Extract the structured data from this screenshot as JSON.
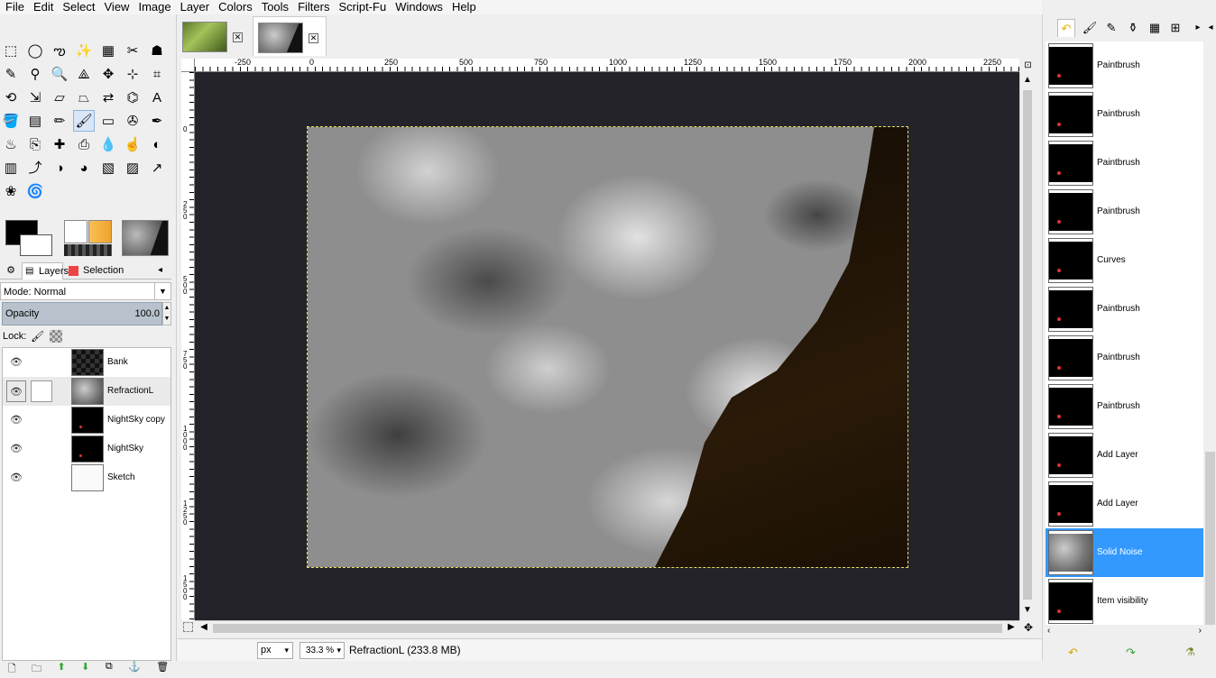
{
  "menubar": {
    "items": [
      "File",
      "Edit",
      "Select",
      "View",
      "Image",
      "Layer",
      "Colors",
      "Tools",
      "Filters",
      "Script-Fu",
      "Windows",
      "Help"
    ]
  },
  "toolbox": {
    "tools": [
      {
        "name": "rect-select-tool",
        "glyph": "⬚"
      },
      {
        "name": "ellipse-select-tool",
        "glyph": "◯"
      },
      {
        "name": "free-select-tool",
        "glyph": "ఌ"
      },
      {
        "name": "fuzzy-select-tool",
        "glyph": "✨"
      },
      {
        "name": "select-by-color-tool",
        "glyph": "▦"
      },
      {
        "name": "scissors-select-tool",
        "glyph": "✂"
      },
      {
        "name": "foreground-select-tool",
        "glyph": "☗"
      },
      {
        "name": "paths-tool",
        "glyph": "✎"
      },
      {
        "name": "color-picker-tool",
        "glyph": "⚲"
      },
      {
        "name": "zoom-tool",
        "glyph": "🔍"
      },
      {
        "name": "measure-tool",
        "glyph": "⟁"
      },
      {
        "name": "move-tool",
        "glyph": "✥"
      },
      {
        "name": "align-tool",
        "glyph": "⊹"
      },
      {
        "name": "crop-tool",
        "glyph": "⌗"
      },
      {
        "name": "rotate-tool",
        "glyph": "⟲"
      },
      {
        "name": "scale-tool",
        "glyph": "⇲"
      },
      {
        "name": "shear-tool",
        "glyph": "▱"
      },
      {
        "name": "perspective-tool",
        "glyph": "⏢"
      },
      {
        "name": "flip-tool",
        "glyph": "⇄"
      },
      {
        "name": "cage-transform-tool",
        "glyph": "⌬"
      },
      {
        "name": "text-tool",
        "glyph": "A"
      },
      {
        "name": "bucket-fill-tool",
        "glyph": "🪣"
      },
      {
        "name": "blend-tool",
        "glyph": "▤"
      },
      {
        "name": "pencil-tool",
        "glyph": "✏"
      },
      {
        "name": "paintbrush-tool",
        "glyph": "🖌"
      },
      {
        "name": "eraser-tool",
        "glyph": "▭"
      },
      {
        "name": "airbrush-tool",
        "glyph": "✇"
      },
      {
        "name": "ink-tool",
        "glyph": "✒"
      },
      {
        "name": "mypaint-brush-tool",
        "glyph": "♨"
      },
      {
        "name": "clone-tool",
        "glyph": "⎘"
      },
      {
        "name": "heal-tool",
        "glyph": "✚"
      },
      {
        "name": "perspective-clone-tool",
        "glyph": "⎙"
      },
      {
        "name": "blur-sharpen-tool",
        "glyph": "💧"
      },
      {
        "name": "smudge-tool",
        "glyph": "☝"
      },
      {
        "name": "dodge-burn-tool",
        "glyph": "◐"
      },
      {
        "name": "levels-tool",
        "glyph": "▥"
      },
      {
        "name": "curves-tool",
        "glyph": "⤴"
      },
      {
        "name": "color-balance-tool",
        "glyph": "◑"
      },
      {
        "name": "hue-saturation-tool",
        "glyph": "◕"
      },
      {
        "name": "color-temperature-tool",
        "glyph": "▧"
      },
      {
        "name": "histogram-tool",
        "glyph": "▨"
      },
      {
        "name": "warp-tool",
        "glyph": "↗"
      },
      {
        "name": "gegl-op-tool",
        "glyph": "❀"
      },
      {
        "name": "spiral-tool",
        "glyph": "🌀"
      }
    ]
  },
  "dock": {
    "tabs": [
      "Layers",
      "Selection"
    ],
    "mode_label": "Mode: Normal",
    "opacity_label": "Opacity",
    "opacity_value": "100.0",
    "lock_label": "Lock:"
  },
  "layers": [
    {
      "name": "Bank",
      "thumb": "checker"
    },
    {
      "name": "RefractionL",
      "thumb": "noise"
    },
    {
      "name": "NightSky copy",
      "thumb": "night"
    },
    {
      "name": "NightSky",
      "thumb": "night"
    },
    {
      "name": "Sketch",
      "thumb": "sketch"
    }
  ],
  "ruler": {
    "h_labels": [
      "-250",
      "0",
      "250",
      "500",
      "750",
      "1000",
      "1250",
      "1500",
      "1750",
      "2000",
      "2250"
    ],
    "v_labels": [
      "0",
      "250",
      "500",
      "750",
      "1000",
      "1250",
      "1500"
    ]
  },
  "statusbar": {
    "unit": "px",
    "zoom": "33.3 %",
    "text": "RefractionL (233.8 MB)"
  },
  "history": [
    {
      "label": "Paintbrush"
    },
    {
      "label": "Paintbrush"
    },
    {
      "label": "Paintbrush"
    },
    {
      "label": "Paintbrush"
    },
    {
      "label": "Curves"
    },
    {
      "label": "Paintbrush"
    },
    {
      "label": "Paintbrush"
    },
    {
      "label": "Paintbrush"
    },
    {
      "label": "Add Layer"
    },
    {
      "label": "Add Layer"
    },
    {
      "label": "Solid Noise"
    },
    {
      "label": "Item visibility"
    }
  ],
  "colors": {
    "canvas_bg": "#232329",
    "selection_highlight": "#3399ff"
  }
}
